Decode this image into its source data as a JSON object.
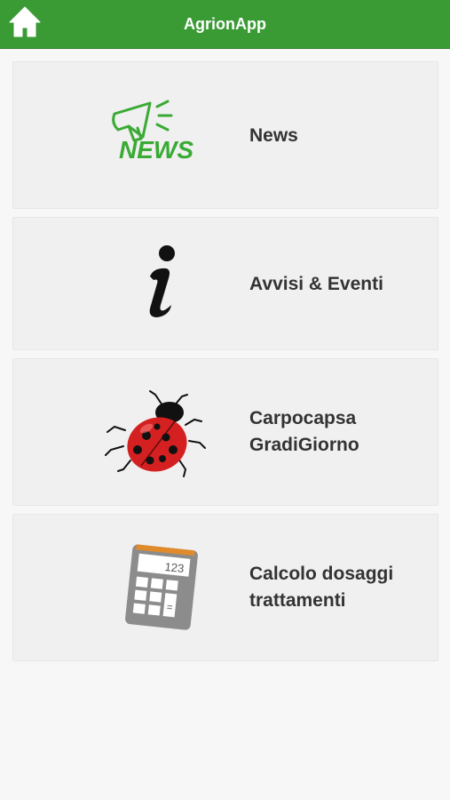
{
  "app_bar": {
    "title": "AgrionApp",
    "home_icon": "home-icon",
    "color": "#3a9b35"
  },
  "menu": {
    "items": [
      {
        "label": "News",
        "icon": "news-megaphone-icon"
      },
      {
        "label": "Avvisi & Eventi",
        "icon": "info-icon"
      },
      {
        "label": "Carpocapsa\nGradiGiorno",
        "icon": "ladybug-icon"
      },
      {
        "label": "Calcolo dosaggi\ntrattamenti",
        "icon": "calculator-icon"
      }
    ],
    "news_logo_text": "NEWS",
    "calculator_display": "123",
    "calculator_equals": "="
  }
}
